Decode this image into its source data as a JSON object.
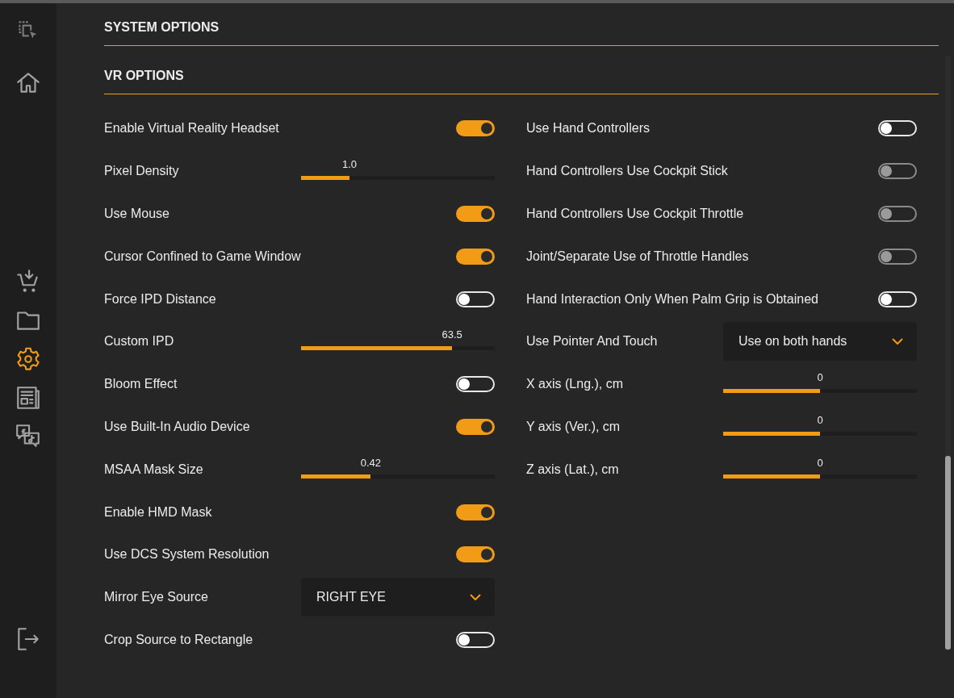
{
  "sidebar": {
    "top_items": [
      {
        "selected": false
      },
      {
        "selected": false
      }
    ],
    "middle_items": [
      {
        "selected": false
      },
      {
        "selected": false
      },
      {
        "selected": true
      },
      {
        "selected": false
      },
      {
        "selected": false
      }
    ],
    "bottom_items": [
      {
        "selected": false
      }
    ]
  },
  "sections": [
    {
      "title": "SYSTEM OPTIONS"
    },
    {
      "title": "VR OPTIONS"
    }
  ],
  "left_settings": [
    {
      "label": "Enable Virtual Reality Headset",
      "kind": "toggle",
      "on": true,
      "disabled": false
    },
    {
      "label": "Pixel Density",
      "kind": "slider",
      "level": 0.25,
      "reading": "1.0"
    },
    {
      "label": "Use Mouse",
      "kind": "toggle",
      "on": true,
      "disabled": false
    },
    {
      "label": "Cursor Confined to Game Window",
      "kind": "toggle",
      "on": true,
      "disabled": false
    },
    {
      "label": "Force IPD Distance",
      "kind": "toggle",
      "on": false,
      "disabled": false
    },
    {
      "label": "Custom IPD",
      "kind": "slider",
      "level": 0.78,
      "reading": "63.5"
    },
    {
      "label": "Bloom Effect",
      "kind": "toggle",
      "on": false,
      "disabled": false
    },
    {
      "label": "Use Built-In Audio Device",
      "kind": "toggle",
      "on": true,
      "disabled": false
    },
    {
      "label": "MSAA Mask Size",
      "kind": "slider",
      "level": 0.36,
      "reading": "0.42"
    },
    {
      "label": "Enable HMD Mask",
      "kind": "toggle",
      "on": true,
      "disabled": false
    },
    {
      "label": "Use DCS System Resolution",
      "kind": "toggle",
      "on": true,
      "disabled": false
    },
    {
      "label": "Mirror Eye Source",
      "kind": "dropdown",
      "value": "RIGHT EYE"
    },
    {
      "label": "Crop Source to Rectangle",
      "kind": "toggle",
      "on": false,
      "disabled": false
    }
  ],
  "right_settings": [
    {
      "label": "Use Hand Controllers",
      "kind": "toggle",
      "on": false,
      "disabled": false
    },
    {
      "label": "Hand Controllers Use Cockpit Stick",
      "kind": "toggle",
      "on": false,
      "disabled": true
    },
    {
      "label": "Hand Controllers Use Cockpit Throttle",
      "kind": "toggle",
      "on": false,
      "disabled": true
    },
    {
      "label": "Joint/Separate Use of Throttle Handles",
      "kind": "toggle",
      "on": false,
      "disabled": true
    },
    {
      "label": "Hand Interaction Only When Palm Grip is Obtained",
      "kind": "toggle",
      "on": false,
      "disabled": false
    },
    {
      "label": "Use Pointer And Touch",
      "kind": "dropdown",
      "value": "Use on both hands"
    },
    {
      "label": "X axis (Lng.), cm",
      "kind": "slider",
      "level": 0.5,
      "reading": "0"
    },
    {
      "label": "Y axis (Ver.), cm",
      "kind": "slider",
      "level": 0.5,
      "reading": "0"
    },
    {
      "label": "Z axis (Lat.), cm",
      "kind": "slider",
      "level": 0.5,
      "reading": "0"
    }
  ]
}
